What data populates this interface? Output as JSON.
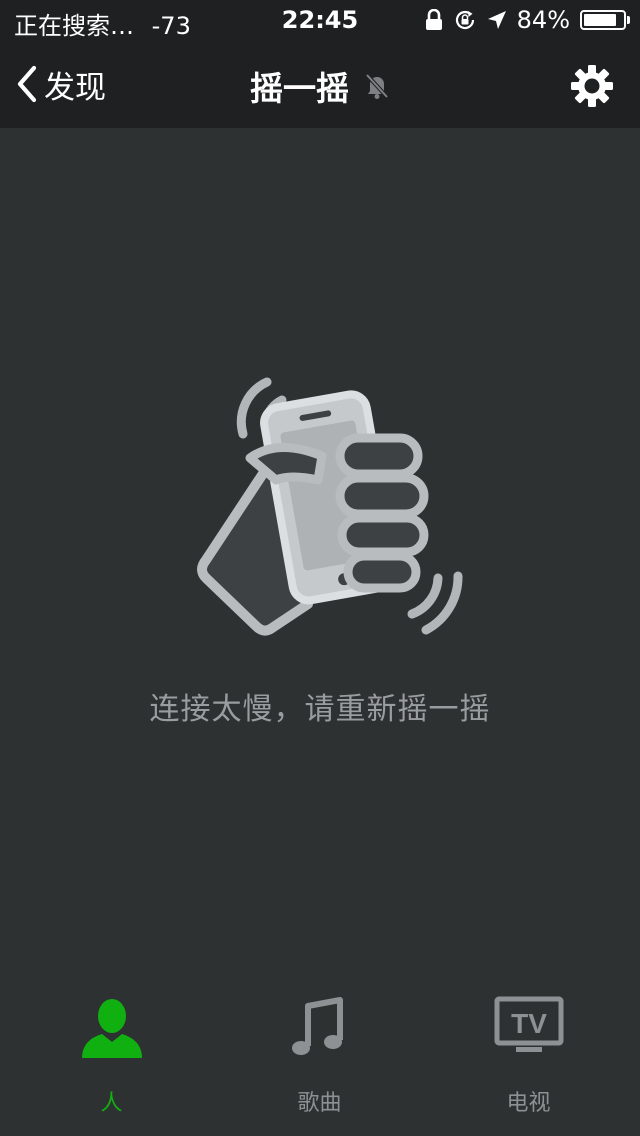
{
  "status_bar": {
    "carrier": "正在搜索…",
    "signal": "-73",
    "time": "22:45",
    "battery": "84%",
    "battery_level": 0.84
  },
  "nav": {
    "back_label": "发现",
    "title": "摇一摇",
    "icons": [
      "chevron-left-icon",
      "mute-bell-icon",
      "gear-icon"
    ]
  },
  "main": {
    "illustration": "hand-shaking-phone-icon",
    "message": "连接太慢，请重新摇一摇"
  },
  "tabs": [
    {
      "label": "人",
      "icon": "person-icon",
      "active": true
    },
    {
      "label": "歌曲",
      "icon": "music-note-icon",
      "active": false
    },
    {
      "label": "电视",
      "icon": "tv-icon",
      "active": false
    }
  ],
  "colors": {
    "background": "#2e3132",
    "bar": "#1f2022",
    "active_tab": "#11b011",
    "inactive": "#8e9193",
    "message": "#9a9d9f"
  }
}
